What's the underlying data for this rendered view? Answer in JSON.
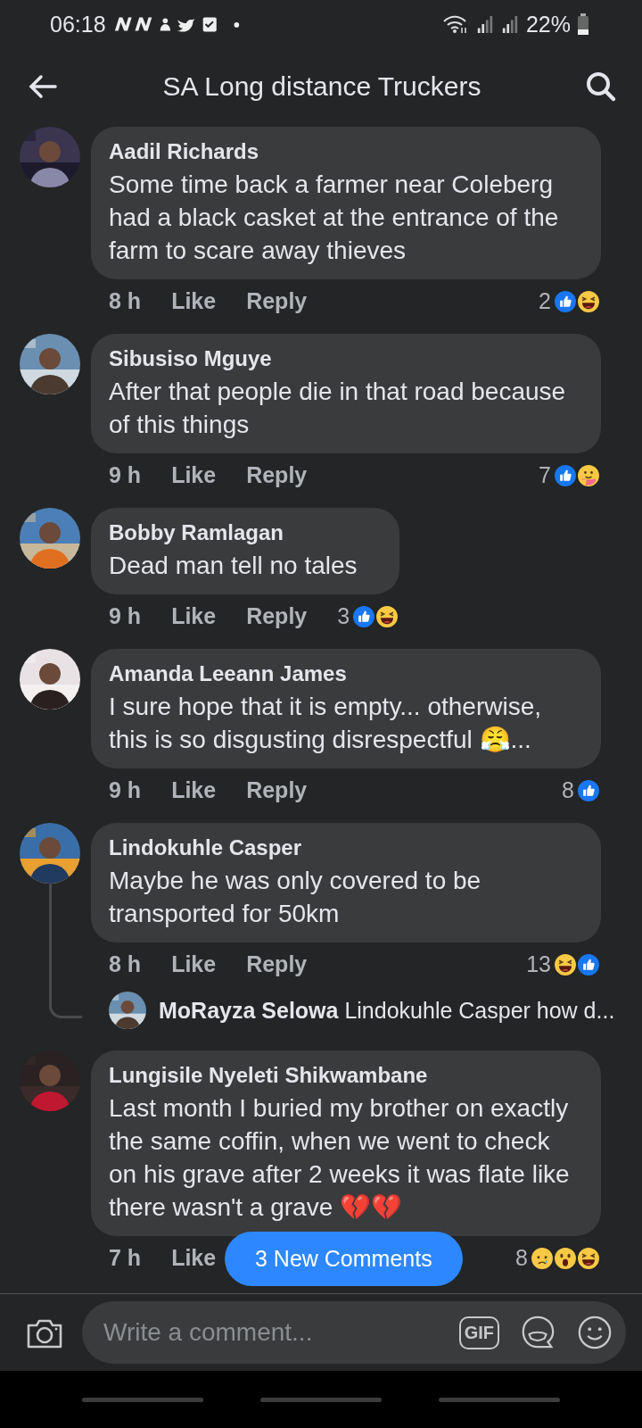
{
  "status_bar": {
    "time": "06:18",
    "battery": "22%"
  },
  "header": {
    "title": "SA Long distance Truckers"
  },
  "comments": [
    {
      "name": "Aadil Richards",
      "text": "Some time back a farmer near Coleberg had a black casket at the entrance of the farm to scare away thieves",
      "time": "8 h",
      "like": "Like",
      "reply": "Reply",
      "reaction_count": "2",
      "reactions": [
        {
          "kind": "like"
        },
        {
          "kind": "haha"
        }
      ]
    },
    {
      "name": "Sibusiso Mguye",
      "text": "After that people die in that road because of this things",
      "time": "9 h",
      "like": "Like",
      "reply": "Reply",
      "reaction_count": "7",
      "reactions": [
        {
          "kind": "like"
        },
        {
          "kind": "care"
        }
      ]
    },
    {
      "name": "Bobby Ramlagan",
      "text": "Dead man tell no tales",
      "time": "9 h",
      "like": "Like",
      "reply": "Reply",
      "reaction_count": "3",
      "reactions": [
        {
          "kind": "like"
        },
        {
          "kind": "haha"
        }
      ]
    },
    {
      "name": "Amanda Leeann James",
      "text": "I sure hope that it is empty... otherwise, this is so disgusting disrespectful 😤...",
      "time": "9 h",
      "like": "Like",
      "reply": "Reply",
      "reaction_count": "8",
      "reactions": [
        {
          "kind": "like"
        }
      ]
    },
    {
      "name": "Lindokuhle Casper",
      "text": "Maybe he was only covered to be transported for 50km",
      "time": "8 h",
      "like": "Like",
      "reply": "Reply",
      "reaction_count": "13",
      "reactions": [
        {
          "kind": "haha"
        },
        {
          "kind": "like"
        }
      ],
      "replies": [
        {
          "name": "MoRayza Selowa",
          "text": "Lindokuhle Casper how d..."
        }
      ]
    },
    {
      "name": "Lungisile Nyeleti Shikwambane",
      "text": "Last month I buried my brother on exactly the same coffin, when we went to check on his grave after 2 weeks it was flate like there wasn't a grave 💔💔",
      "time": "7 h",
      "like": "Like",
      "reaction_count": "8",
      "reactions": [
        {
          "kind": "sad"
        },
        {
          "kind": "wow"
        },
        {
          "kind": "haha"
        }
      ]
    }
  ],
  "new_comments_button": "3 New Comments",
  "composer": {
    "placeholder": "Write a comment...",
    "gif_button": "GIF"
  }
}
